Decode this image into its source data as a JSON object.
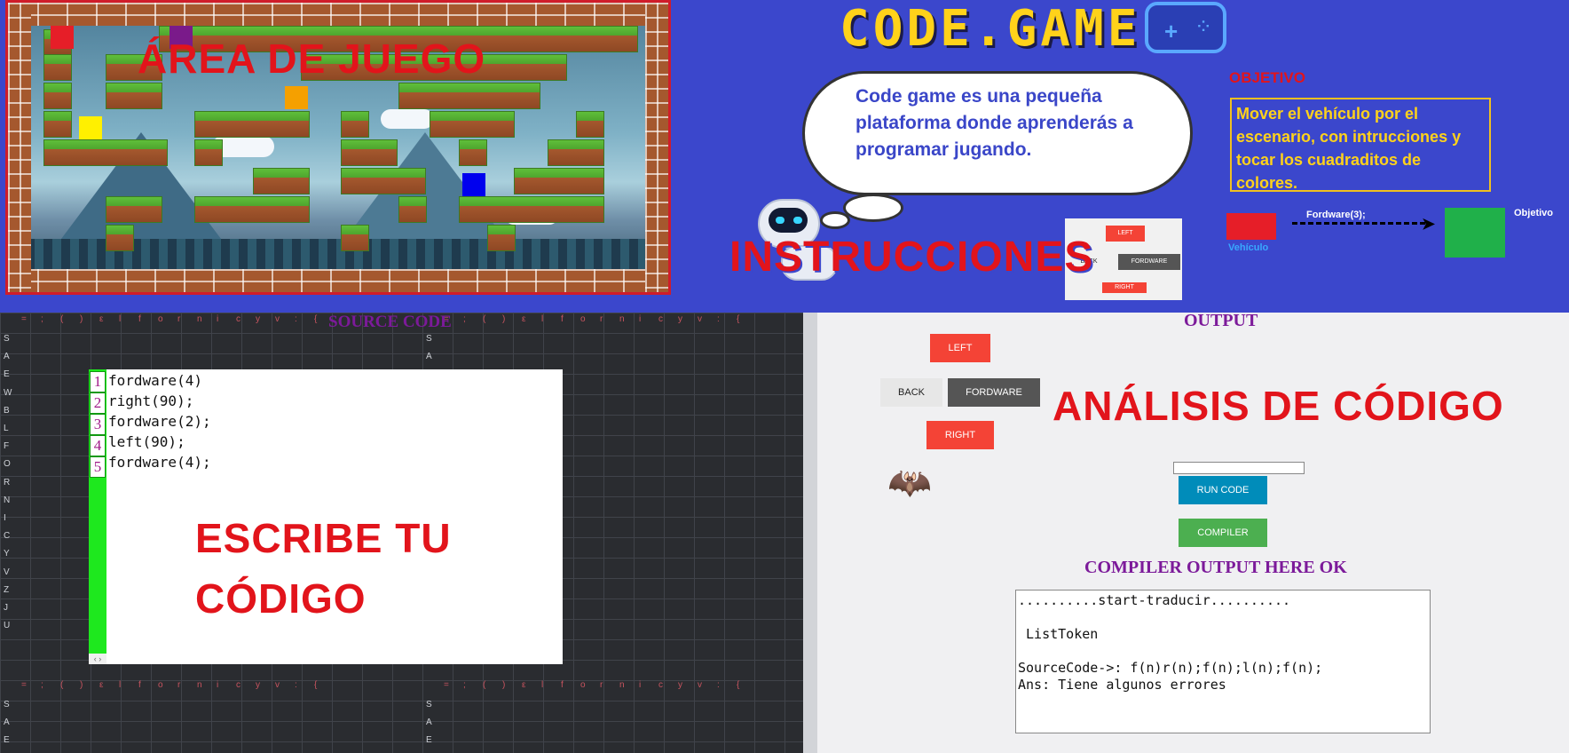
{
  "banner": {
    "game_area_title": "ÁREA DE JUEGO",
    "logo": "CODE.GAME",
    "bubble_text": "Code game es una pequeña plataforma donde aprenderás a programar jugando.",
    "objective_heading": "OBJETIVO",
    "objective_text": "Mover el vehículo por el escenario, con intrucciones y tocar los cuadraditos de colores.",
    "instructions_title": "INSTRUCCIONES",
    "mini_buttons": {
      "left": "LEFT",
      "back": "BACK",
      "forward": "FORDWARE",
      "right": "RIGHT"
    },
    "vehicle_label": "Vehículo",
    "forward_example": "Fordware(3);",
    "goal_label": "Objetivo",
    "colors": {
      "vehicle": "#e61e28",
      "goal": "#20b04a",
      "title_red": "#e2141b",
      "logo_yellow": "#ffd21a"
    }
  },
  "game": {
    "squares": [
      {
        "color": "#e61e28"
      },
      {
        "color": "#7a1a8a"
      },
      {
        "color": "#f5a000"
      },
      {
        "color": "#fff000"
      },
      {
        "color": "#0000ee"
      }
    ]
  },
  "editor": {
    "source_title": "SOURCE CODE",
    "line_numbers": [
      "1",
      "2",
      "3",
      "4",
      "5"
    ],
    "lines": [
      "fordware(4)",
      "right(90);",
      "fordware(2);",
      "left(90);",
      "fordware(4);"
    ],
    "write_title_1": "ESCRIBE TU",
    "write_title_2": "CÓDIGO",
    "grid_header": [
      "=",
      ";",
      "(",
      ")",
      "ε",
      "l",
      "f",
      "o",
      "r",
      "n",
      "i",
      "c",
      "y",
      "v",
      ":",
      "{"
    ],
    "grid_rows": [
      "S",
      "A",
      "E",
      "W",
      "B",
      "L",
      "F",
      "O",
      "R",
      "N",
      "I",
      "C",
      "Y",
      "V",
      "Z",
      "J",
      "U"
    ]
  },
  "output": {
    "title": "OUTPUT",
    "buttons": {
      "left": "LEFT",
      "back": "BACK",
      "forward": "FORDWARE",
      "right": "RIGHT",
      "run": "RUN CODE",
      "compiler": "COMPILER"
    },
    "analysis_title": "ANÁLISIS DE CÓDIGO",
    "compiler_title": "COMPILER OUTPUT HERE OK",
    "compiler_text": "..........start-traducir..........\n\n ListToken\n\nSourceCode->: f(n)r(n);f(n);l(n);f(n);\nAns: Tiene algunos errores"
  }
}
